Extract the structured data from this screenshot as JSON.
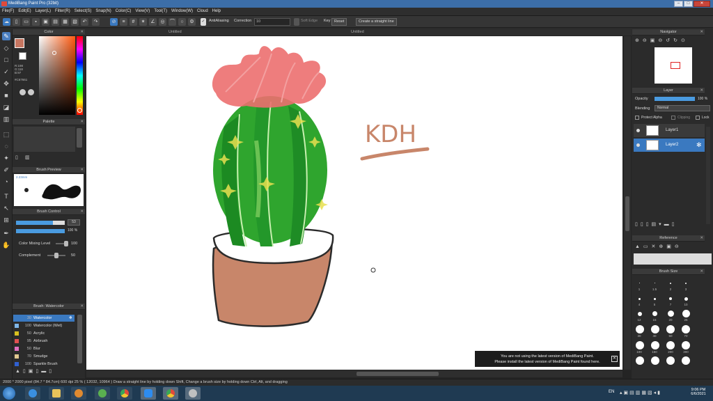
{
  "window": {
    "title": "MediBang Paint Pro (32bit)",
    "min": "–",
    "max": "□",
    "close": "✕"
  },
  "menu": [
    "File(F)",
    "Edit(E)",
    "Layer(L)",
    "Filter(R)",
    "Select(S)",
    "Snap(N)",
    "Color(C)",
    "View(V)",
    "Tool(T)",
    "Window(W)",
    "Cloud",
    "Help"
  ],
  "toolbar": {
    "antialiasing": "AntiAliasing",
    "correction_label": "Correction",
    "correction_value": "10",
    "soft_edge": "Soft Edge",
    "key": "Key",
    "reset": "Reset",
    "straight_line": "Create a straight line"
  },
  "tabs": {
    "left": "Untitled",
    "main": "Untitled"
  },
  "panels": {
    "color": "Color",
    "palette": "Palette",
    "brush_preview": "Brush Preview",
    "brush_control": "Brush Control",
    "brush_watercolor": "Brush: Watercolor",
    "navigator": "Navigator",
    "layer": "Layer",
    "reference": "Reference",
    "brush_size": "Brush Size"
  },
  "color": {
    "rgb": [
      "R:198",
      "G:118",
      "B:97"
    ],
    "hex": "#C67661",
    "primary": "#c67661",
    "secondary": "#ffffff"
  },
  "brush_preview_size": "2.23mm",
  "brush_control": {
    "size_value": "53",
    "size_fraction": 0.75,
    "opacity_value": "100",
    "opacity_unit": "%",
    "opacity_fraction": 1.0,
    "color_mixing_label": "Color Mixing Level",
    "color_mixing_value": "100",
    "complement_label": "Complement",
    "complement_value": "50"
  },
  "brushes": [
    {
      "size": "30",
      "name": "Watercolor",
      "color": "#3a79c0",
      "selected": true
    },
    {
      "size": "100",
      "name": "Watercolor (Wet)",
      "color": "#7fb6e8",
      "selected": false
    },
    {
      "size": "50",
      "name": "Acrylic",
      "color": "#d8c020",
      "selected": false
    },
    {
      "size": "95",
      "name": "Airbrush",
      "color": "#e05050",
      "selected": false
    },
    {
      "size": "50",
      "name": "Blur",
      "color": "#e070c0",
      "selected": false
    },
    {
      "size": "70",
      "name": "Smudge",
      "color": "#e0c890",
      "selected": false
    },
    {
      "size": "100",
      "name": "Sparkle Brush",
      "color": "#3060d0",
      "selected": false
    }
  ],
  "layer_panel": {
    "opacity_label": "Opacity",
    "opacity_value": "100 %",
    "blending_label": "Blending",
    "blending_value": "Normal",
    "protect_alpha": "Protect Alpha",
    "clipping": "Clipping",
    "lock": "Lock",
    "layers": [
      {
        "name": "Layer1",
        "selected": false
      },
      {
        "name": "Layer2",
        "selected": true
      }
    ]
  },
  "canvas_text": "KDH",
  "notice": {
    "line1": "You are not using the latest version of MediBang Paint.",
    "line2": "Please install the latest version of MediBang Paint found here."
  },
  "brush_sizes": [
    "1",
    "1.5",
    "2",
    "3",
    "4",
    "5",
    "7",
    "10",
    "12",
    "15",
    "20",
    "25",
    "30",
    "40",
    "50",
    "70",
    "100",
    "150",
    "200",
    "300"
  ],
  "status": "2000 * 2000 pixel  (84.7 * 84.7cm)  600 dpi  25 %  ( 12032, 10964 )  Draw a straight line by holding down Shift, Change a brush size by holding down Ctrl, Alt, and dragging",
  "taskbar": {
    "lang": "EN",
    "time": "9:06 PM",
    "date": "6/6/2021"
  }
}
